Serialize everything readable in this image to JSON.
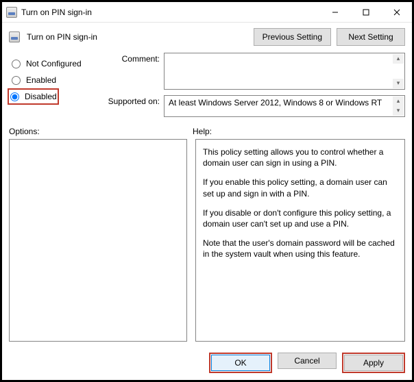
{
  "titlebar": {
    "title": "Turn on PIN sign-in"
  },
  "header": {
    "policy_title": "Turn on PIN sign-in",
    "prev": "Previous Setting",
    "next": "Next Setting"
  },
  "radios": {
    "not_configured": "Not Configured",
    "enabled": "Enabled",
    "disabled": "Disabled",
    "selected": "disabled"
  },
  "fields": {
    "comment_label": "Comment:",
    "comment_value": "",
    "supported_label": "Supported on:",
    "supported_value": "At least Windows Server 2012, Windows 8 or Windows RT"
  },
  "panes": {
    "options_label": "Options:",
    "help_label": "Help:",
    "help_paragraphs": {
      "p1": "This policy setting allows you to control whether a domain user can sign in using a PIN.",
      "p2": "If you enable this policy setting, a domain user can set up and sign in with a PIN.",
      "p3": "If you disable or don't configure this policy setting, a domain user can't set up and use a PIN.",
      "p4": "Note that the user's domain password will be cached in the system vault when using this feature."
    }
  },
  "buttons": {
    "ok": "OK",
    "cancel": "Cancel",
    "apply": "Apply"
  }
}
